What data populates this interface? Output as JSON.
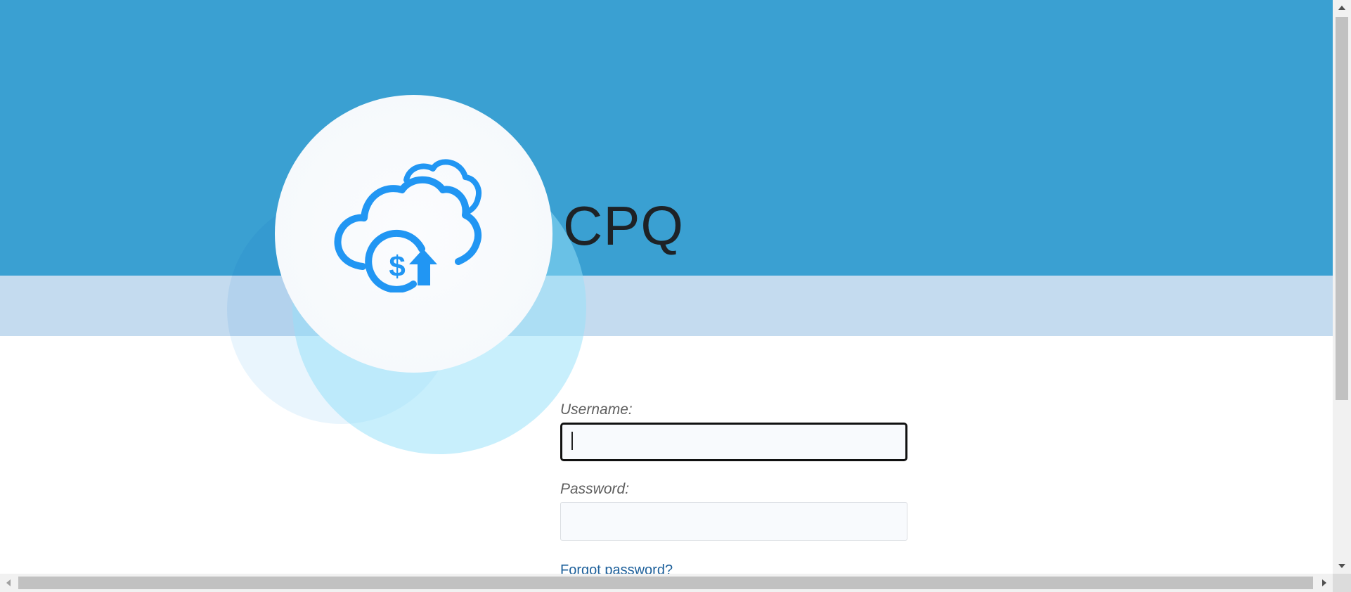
{
  "app": {
    "title": "CPQ",
    "logo_icon": "cloud-dollar-upload-icon"
  },
  "colors": {
    "header_blue": "#3aa0d2",
    "header_band_light": "#c4dbef",
    "logo_blue": "#2196f3",
    "link": "#1c5f9a"
  },
  "login": {
    "username_label": "Username:",
    "username_value": "",
    "password_label": "Password:",
    "password_value": "",
    "forgot_password": "Forgot password?"
  }
}
